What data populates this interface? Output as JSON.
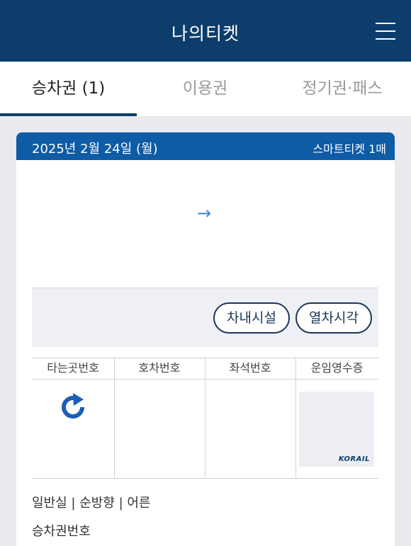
{
  "header": {
    "title": "나의티켓",
    "menu_icon": "hamburger-icon"
  },
  "tabs": [
    {
      "label": "승차권 (1)",
      "active": true
    },
    {
      "label": "이용권",
      "active": false
    },
    {
      "label": "정기권·패스",
      "active": false
    }
  ],
  "ticket": {
    "date": "2025년 2월 24일 (월)",
    "count": "스마트티켓 1매",
    "arrow": "→",
    "buttons": {
      "facilities": "차내시설",
      "timetable": "열차시각"
    },
    "columns": [
      "타는곳번호",
      "호차번호",
      "좌석번호",
      "운임영수증"
    ],
    "receipt_logo": "KORAIL",
    "info_line": "일반실 | 순방향 | 어른",
    "ticket_number_label": "승차권번호"
  },
  "colors": {
    "appbar": "#0c3d6b",
    "ticket_header": "#0e5ba6",
    "refresh": "#1a5fb4"
  }
}
